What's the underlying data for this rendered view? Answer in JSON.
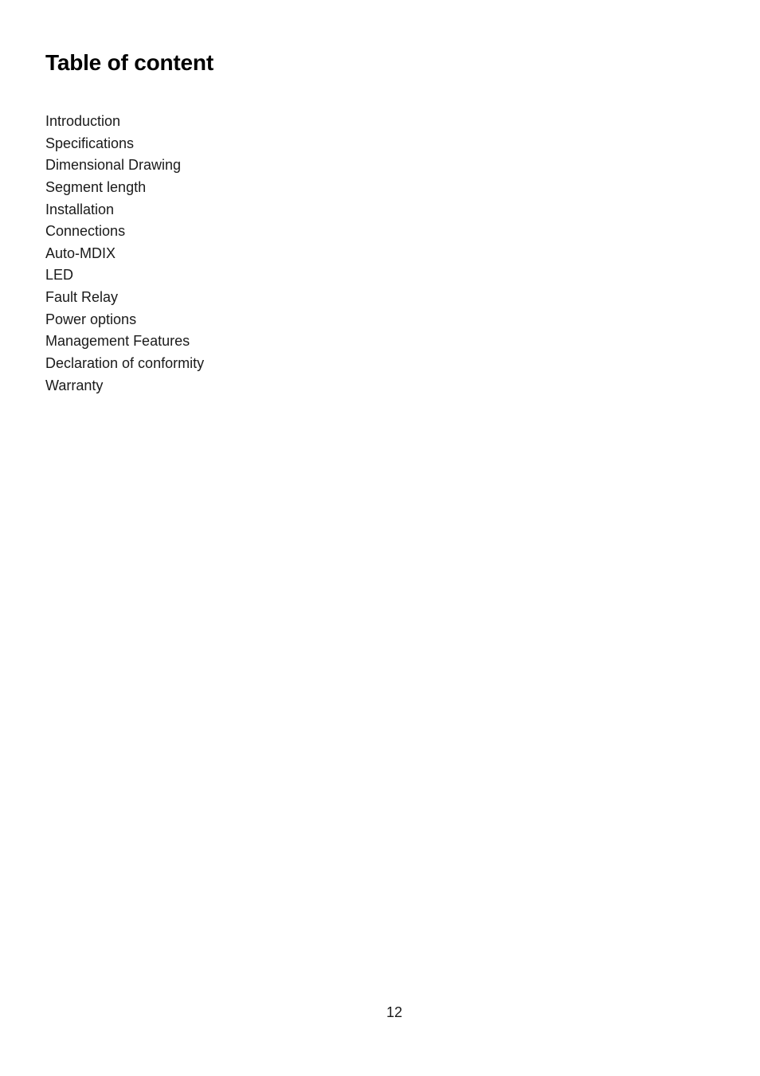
{
  "document": {
    "title": "Table of content",
    "toc_items": [
      {
        "label": "Introduction"
      },
      {
        "label": "Specifications"
      },
      {
        "label": "Dimensional Drawing"
      },
      {
        "label": "Segment length"
      },
      {
        "label": "Installation"
      },
      {
        "label": "Connections"
      },
      {
        "label": "Auto-MDIX"
      },
      {
        "label": "LED"
      },
      {
        "label": "Fault Relay"
      },
      {
        "label": "Power options"
      },
      {
        "label": "Management Features"
      },
      {
        "label": "Declaration of conformity"
      },
      {
        "label": "Warranty"
      }
    ],
    "page_number": "12"
  }
}
